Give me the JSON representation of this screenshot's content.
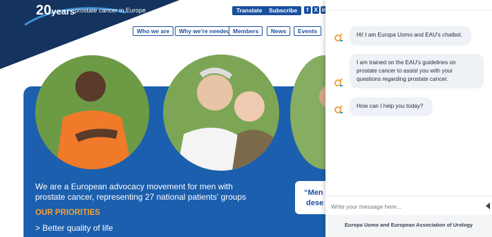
{
  "logo": {
    "years": "20",
    "years_suffix": "years",
    "tagline": "prostate cancer in Europe"
  },
  "top_actions": {
    "translate": "Translate",
    "subscribe": "Subscribe"
  },
  "social": [
    "f",
    "X",
    "in"
  ],
  "nav": {
    "items": [
      "Who we are",
      "Why we're needed",
      "Members",
      "News",
      "Events"
    ]
  },
  "hero": {
    "text": "We are a European advocacy movement for men with prostate cancer, representing 27 national patients' groups",
    "priorities_heading": "OUR PRIORITIES",
    "priority_1": "Better quality of life",
    "quote": "“Men\n dese"
  },
  "chatbot": {
    "messages": [
      "Hi! I am Europa Uomo and EAU's chatbot.",
      "I am trained on the EAU's guidelines on prostate cancer to assist you with your questions regarding prostate cancer.",
      "How can I help you today?"
    ],
    "input_placeholder": "Write your message here...",
    "footer": "Europa Uomo and European Association of Urology"
  },
  "colors": {
    "brand_dark": "#15335f",
    "brand_blue": "#1b5fae",
    "accent_orange": "#f2a23a",
    "bubble_bg": "#eef1f5"
  }
}
